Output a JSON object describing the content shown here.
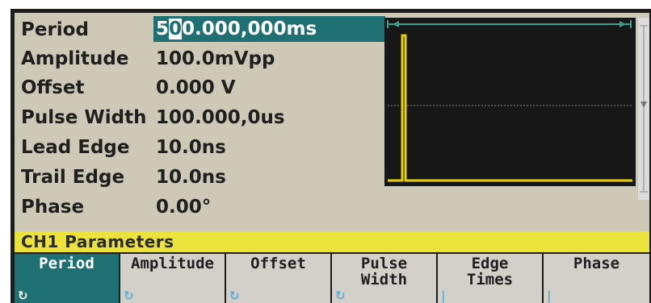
{
  "parameters": [
    {
      "label": "Period",
      "value_pre": "5",
      "value_cursor": "0",
      "value_post": "0.000,000ms"
    },
    {
      "label": "Amplitude",
      "value": "100.0mVpp"
    },
    {
      "label": "Offset",
      "value": "0.000 V"
    },
    {
      "label": "Pulse Width",
      "value": "100.000,0us"
    },
    {
      "label": "Lead Edge",
      "value": "10.0ns"
    },
    {
      "label": "Trail Edge",
      "value": "10.0ns"
    },
    {
      "label": "Phase",
      "value": "0.00°"
    }
  ],
  "status": {
    "text": "CH1  Parameters"
  },
  "softkeys": [
    {
      "label": "Period",
      "icon": "rotate-knob-icon",
      "active": true
    },
    {
      "label": "Amplitude",
      "icon": "rotate-knob-icon",
      "active": false
    },
    {
      "label": "Offset",
      "icon": "rotate-knob-icon",
      "active": false
    },
    {
      "label": "Pulse\nWidth",
      "icon": "rotate-knob-icon",
      "active": false
    },
    {
      "label": "Edge\nTimes",
      "icon": "submenu-bar-icon",
      "active": false
    },
    {
      "label": "Phase",
      "icon": "submenu-bar-icon",
      "active": false
    }
  ],
  "colors": {
    "selection": "#1f7073",
    "trace": "#e8d000",
    "status_bar": "#ece23c",
    "marker": "#3aa08f"
  }
}
